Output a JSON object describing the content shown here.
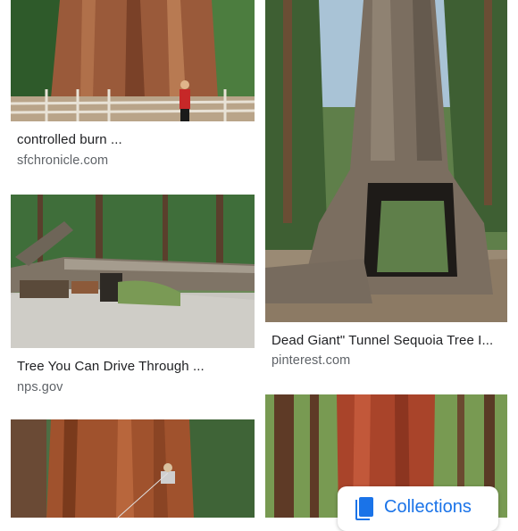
{
  "results": [
    {
      "caption": "controlled burn ...",
      "source": "sfchronicle.com",
      "image": "giant-sequoia-trunk-with-person"
    },
    {
      "caption": "Tree You Can Drive Through ...",
      "source": "nps.gov",
      "image": "fallen-tunnel-log"
    },
    {
      "caption": "Dead Giant\" Tunnel Sequoia Tree I...",
      "source": "pinterest.com",
      "image": "tunnel-tree-trunk"
    },
    {
      "caption": "",
      "source": "",
      "image": "sequoia-with-climber"
    },
    {
      "caption": "",
      "source": "",
      "image": "redwood-forest"
    }
  ],
  "collections_button": {
    "label": "Collections",
    "icon": "bookmark-icon"
  },
  "colors": {
    "accent": "#1a73e8",
    "caption": "#202124",
    "source": "#5f6368"
  }
}
